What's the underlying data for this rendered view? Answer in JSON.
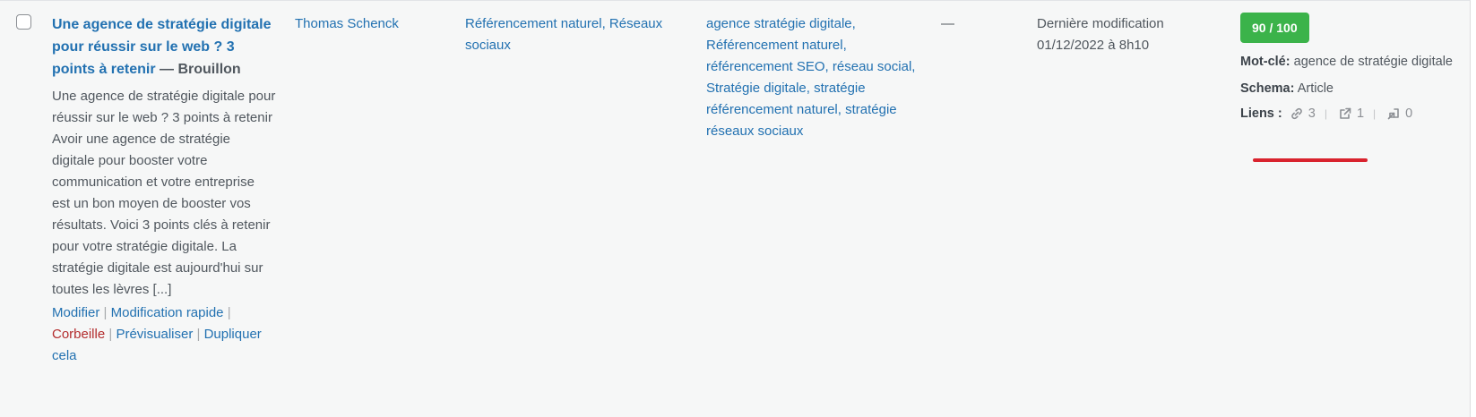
{
  "post": {
    "title": "Une agence de stratégie digitale pour réussir sur le web ? 3 points à retenir",
    "state": "Brouillon",
    "state_separator": " — ",
    "excerpt": "Une agence de stratégie digitale pour réussir sur le web ? 3 points à retenir Avoir une agence de stratégie digitale pour booster votre communication et votre entreprise est un bon moyen de booster vos résultats. Voici 3 points clés à retenir pour votre stratégie digitale. La stratégie digitale est aujourd'hui sur toutes les lèvres [...]",
    "actions": {
      "edit": "Modifier",
      "quick_edit": "Modification rapide",
      "trash": "Corbeille",
      "preview": "Prévisualiser",
      "duplicate": "Dupliquer cela",
      "separator": "|"
    },
    "author": "Thomas Schenck",
    "categories": "Référencement naturel, Réseaux sociaux",
    "tags": "agence stratégie digitale, Référencement naturel, référencement SEO, réseau social, Stratégie digitale, stratégie référencement naturel, stratégie réseaux sociaux",
    "comments": "—",
    "date_label": "Dernière modification",
    "date_value": "01/12/2022 à 8h10"
  },
  "seo": {
    "score": "90 / 100",
    "score_color": "#3bb34a",
    "keyword_label": "Mot-clé:",
    "keyword_value": "agence de stratégie digitale",
    "schema_label": "Schema:",
    "schema_value": "Article",
    "links_label": "Liens :",
    "internal_links": "3",
    "external_links": "1",
    "incoming_links": "0",
    "icons": [
      "link-icon",
      "external-link-icon",
      "incoming-link-icon"
    ],
    "highlight_color": "#d9232e"
  }
}
